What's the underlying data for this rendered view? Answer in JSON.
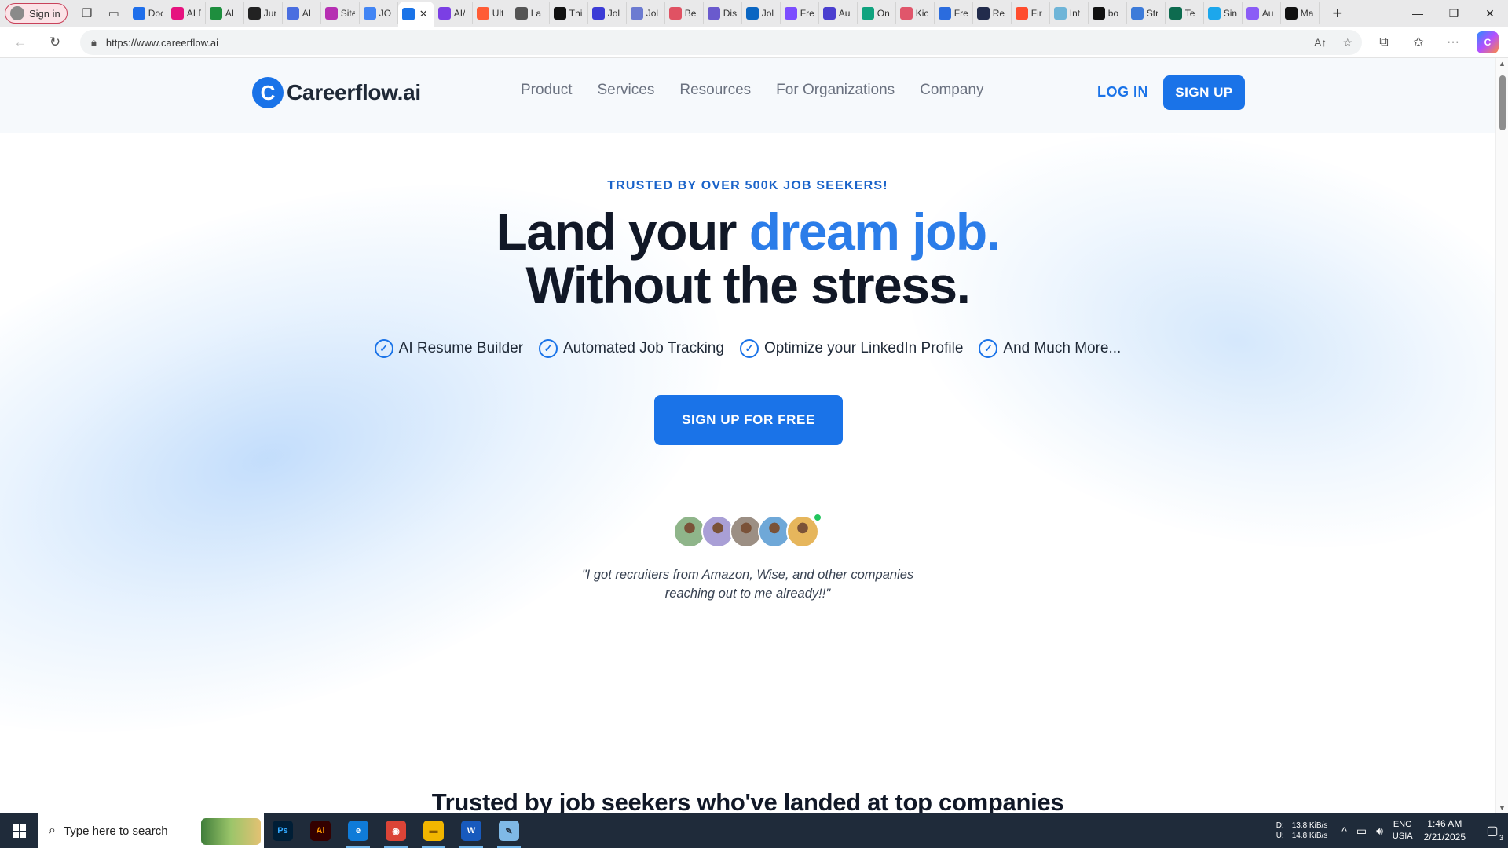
{
  "browser": {
    "profile_label": "Sign in",
    "tabs": [
      {
        "label": "Doc",
        "icon": "docs-icon",
        "color": "#1f6feb"
      },
      {
        "label": "AI D",
        "icon": "ai-detector-icon",
        "color": "#e6137f"
      },
      {
        "label": "AI",
        "icon": "sheets-icon",
        "color": "#1e8e3e"
      },
      {
        "label": "Jur",
        "icon": "target-icon",
        "color": "#222222"
      },
      {
        "label": "AI",
        "icon": "ai-writer-icon",
        "color": "#4a6ee0"
      },
      {
        "label": "Site",
        "icon": "site-icon",
        "color": "#b62fb2"
      },
      {
        "label": "JO",
        "icon": "google-icon",
        "color": "#4285f4"
      },
      {
        "label": "",
        "icon": "careerflow-tab-icon",
        "color": "#1a73e8"
      },
      {
        "label": "AI/",
        "icon": "ai-pen-icon",
        "color": "#7b3fe4"
      },
      {
        "label": "Ult",
        "icon": "hubspot-icon",
        "color": "#ff5c35"
      },
      {
        "label": "La",
        "icon": "feather-icon",
        "color": "#555555"
      },
      {
        "label": "Thi",
        "icon": "openai-icon",
        "color": "#111111"
      },
      {
        "label": "Jol",
        "icon": "jobs-icon",
        "color": "#3b3bd6"
      },
      {
        "label": "Jol",
        "icon": "bot-icon",
        "color": "#6c7bd1"
      },
      {
        "label": "Be",
        "icon": "candy-icon",
        "color": "#e05263"
      },
      {
        "label": "Dis",
        "icon": "shield-tab-icon",
        "color": "#6a5acd"
      },
      {
        "label": "Jol",
        "icon": "linkedin-icon",
        "color": "#0a66c2"
      },
      {
        "label": "Fre",
        "icon": "notion-icon",
        "color": "#7c4dff"
      },
      {
        "label": "Au",
        "icon": "arrow-tab-icon",
        "color": "#4a3fcf"
      },
      {
        "label": "On",
        "icon": "chat-icon",
        "color": "#10a37f"
      },
      {
        "label": "Kic",
        "icon": "swirl-icon",
        "color": "#e0566b"
      },
      {
        "label": "Fre",
        "icon": "cloud-icon",
        "color": "#2b6cde"
      },
      {
        "label": "Re",
        "icon": "r-icon",
        "color": "#222c4c"
      },
      {
        "label": "Fir",
        "icon": "k-icon",
        "color": "#ff4d2e"
      },
      {
        "label": "Int",
        "icon": "drop-icon",
        "color": "#6fb5d8"
      },
      {
        "label": "bo",
        "icon": "circle-tab-icon",
        "color": "#111111"
      },
      {
        "label": "Str",
        "icon": "a-icon",
        "color": "#3d7bd9"
      },
      {
        "label": "Te",
        "icon": "tv-icon",
        "color": "#0d6b4f"
      },
      {
        "label": "Sin",
        "icon": "wave-icon",
        "color": "#1ca7ec"
      },
      {
        "label": "Au",
        "icon": "c-icon",
        "color": "#8b5cf6"
      },
      {
        "label": "Ma",
        "icon": "clover-icon",
        "color": "#111111"
      }
    ],
    "url": "https://www.careerflow.ai"
  },
  "site": {
    "logo_text": "Careerflow.ai",
    "nav": [
      "Product",
      "Services",
      "Resources",
      "For Organizations",
      "Company"
    ],
    "login_label": "LOG IN",
    "signup_label": "SIGN UP",
    "eyebrow": "TRUSTED BY OVER 500K JOB SEEKERS!",
    "headline_line1_a": "Land your ",
    "headline_line1_b": "dream job.",
    "headline_line2": "Without the stress.",
    "features": [
      "AI Resume Builder",
      "Automated Job Tracking",
      "Optimize your LinkedIn Profile",
      "And Much More..."
    ],
    "cta_label": "SIGN UP FOR FREE",
    "avatar_colors": [
      "#8fb58a",
      "#a99fd6",
      "#9c8f84",
      "#6fa8d8",
      "#e6b65c"
    ],
    "testimonial_line1": "\"I got recruiters from Amazon, Wise, and other companies",
    "testimonial_line2": "reaching out to me already!!\"",
    "section_heading": "Trusted by job seekers who've landed at top companies",
    "brand_color": "#1a73e8"
  },
  "taskbar": {
    "search_placeholder": "Type here to search",
    "apps": [
      {
        "name": "photoshop",
        "label": "Ps",
        "color": "#001e36",
        "fg": "#31a8ff"
      },
      {
        "name": "illustrator",
        "label": "Ai",
        "color": "#330000",
        "fg": "#ff9a00"
      },
      {
        "name": "edge",
        "label": "e",
        "color": "#0f7bd8",
        "fg": "#ffffff"
      },
      {
        "name": "chrome",
        "label": "◉",
        "color": "#db4437",
        "fg": "#ffffff"
      },
      {
        "name": "file-explorer",
        "label": "▬",
        "color": "#f2b600",
        "fg": "#8a5a00"
      },
      {
        "name": "word",
        "label": "W",
        "color": "#185abd",
        "fg": "#ffffff"
      },
      {
        "name": "notepad",
        "label": "✎",
        "color": "#7fb9e6",
        "fg": "#1f2b3a"
      }
    ],
    "net_down_label": "D:",
    "net_down_value": "13.8 KiB/s",
    "net_up_label": "U:",
    "net_up_value": "14.8 KiB/s",
    "lang_top": "ENG",
    "lang_bottom": "USIA",
    "time": "1:46 AM",
    "date": "2/21/2025",
    "notification_count": "3"
  }
}
